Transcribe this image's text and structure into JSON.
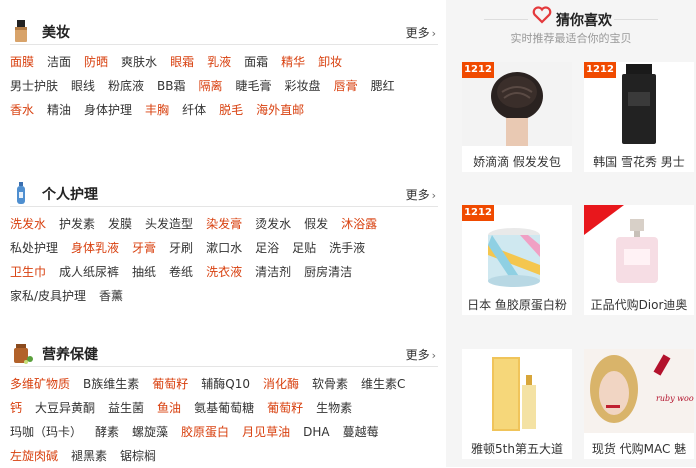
{
  "categories": [
    {
      "title": "美妆",
      "more": "更多",
      "rows": [
        [
          {
            "t": "面膜",
            "hot": true
          },
          {
            "t": "洁面",
            "hot": false
          },
          {
            "t": "防晒",
            "hot": true
          },
          {
            "t": "爽肤水",
            "hot": false
          },
          {
            "t": "眼霜",
            "hot": true
          },
          {
            "t": "乳液",
            "hot": true
          },
          {
            "t": "面霜",
            "hot": false
          },
          {
            "t": "精华",
            "hot": true
          },
          {
            "t": "卸妆",
            "hot": true
          }
        ],
        [
          {
            "t": "男士护肤",
            "hot": false
          },
          {
            "t": "眼线",
            "hot": false
          },
          {
            "t": "粉底液",
            "hot": false
          },
          {
            "t": "BB霜",
            "hot": false
          },
          {
            "t": "隔离",
            "hot": true
          },
          {
            "t": "睫毛膏",
            "hot": false
          },
          {
            "t": "彩妆盘",
            "hot": false
          },
          {
            "t": "唇膏",
            "hot": true
          },
          {
            "t": "腮红",
            "hot": false
          }
        ],
        [
          {
            "t": "香水",
            "hot": true
          },
          {
            "t": "精油",
            "hot": false
          },
          {
            "t": "身体护理",
            "hot": false
          },
          {
            "t": "丰胸",
            "hot": true
          },
          {
            "t": "纤体",
            "hot": false
          },
          {
            "t": "脱毛",
            "hot": true
          },
          {
            "t": "海外直邮",
            "hot": true
          }
        ]
      ]
    },
    {
      "title": "个人护理",
      "more": "更多",
      "rows": [
        [
          {
            "t": "洗发水",
            "hot": true
          },
          {
            "t": "护发素",
            "hot": false
          },
          {
            "t": "发膜",
            "hot": false
          },
          {
            "t": "头发造型",
            "hot": false
          },
          {
            "t": "染发膏",
            "hot": true
          },
          {
            "t": "烫发水",
            "hot": false
          },
          {
            "t": "假发",
            "hot": false
          },
          {
            "t": "沐浴露",
            "hot": true
          }
        ],
        [
          {
            "t": "私处护理",
            "hot": false
          },
          {
            "t": "身体乳液",
            "hot": true
          },
          {
            "t": "牙膏",
            "hot": true
          },
          {
            "t": "牙刷",
            "hot": false
          },
          {
            "t": "漱口水",
            "hot": false
          },
          {
            "t": "足浴",
            "hot": false
          },
          {
            "t": "足贴",
            "hot": false
          },
          {
            "t": "洗手液",
            "hot": false
          }
        ],
        [
          {
            "t": "卫生巾",
            "hot": true
          },
          {
            "t": "成人纸尿裤",
            "hot": false
          },
          {
            "t": "抽纸",
            "hot": false
          },
          {
            "t": "卷纸",
            "hot": false
          },
          {
            "t": "洗衣液",
            "hot": true
          },
          {
            "t": "清洁剂",
            "hot": false
          },
          {
            "t": "厨房清洁",
            "hot": false
          }
        ],
        [
          {
            "t": "家私/皮具护理",
            "hot": false
          },
          {
            "t": "香薰",
            "hot": false
          }
        ]
      ]
    },
    {
      "title": "营养保健",
      "more": "更多",
      "rows": [
        [
          {
            "t": "多维矿物质",
            "hot": true
          },
          {
            "t": "B族维生素",
            "hot": false
          },
          {
            "t": "葡萄籽",
            "hot": true
          },
          {
            "t": "辅酶Q10",
            "hot": false
          },
          {
            "t": "消化酶",
            "hot": true
          },
          {
            "t": "软骨素",
            "hot": false
          },
          {
            "t": "维生素C",
            "hot": false
          }
        ],
        [
          {
            "t": "钙",
            "hot": true
          },
          {
            "t": "大豆异黄酮",
            "hot": false
          },
          {
            "t": "益生菌",
            "hot": false
          },
          {
            "t": "鱼油",
            "hot": true
          },
          {
            "t": "氨基葡萄糖",
            "hot": false
          },
          {
            "t": "葡萄籽",
            "hot": true
          },
          {
            "t": "生物素",
            "hot": false
          }
        ],
        [
          {
            "t": "玛咖（玛卡）",
            "hot": false
          },
          {
            "t": "酵素",
            "hot": false
          },
          {
            "t": "螺旋藻",
            "hot": false
          },
          {
            "t": "胶原蛋白",
            "hot": true
          },
          {
            "t": "月见草油",
            "hot": true
          },
          {
            "t": "DHA",
            "hot": false
          },
          {
            "t": "蔓越莓",
            "hot": false
          }
        ],
        [
          {
            "t": "左旋肉碱",
            "hot": true
          },
          {
            "t": "褪黑素",
            "hot": false
          },
          {
            "t": "锯棕榈",
            "hot": false
          }
        ]
      ]
    }
  ],
  "favorites": {
    "title": "猜你喜欢",
    "subtitle": "实时推荐最适合你的宝贝",
    "items": [
      {
        "name": "娇滴滴 假发发包",
        "badge": "1212"
      },
      {
        "name": "韩国 雪花秀 男士",
        "badge": "1212"
      },
      {
        "name": "日本 鱼胶原蛋白粉",
        "badge": "1212"
      },
      {
        "name": "正品代购Dior迪奥",
        "badge": ""
      },
      {
        "name": "雅顿5th第五大道",
        "badge": ""
      },
      {
        "name": "现货 代购MAC 魅",
        "badge": ""
      }
    ]
  },
  "colors": {
    "hot": "#d8400f",
    "badge": "#f04a00",
    "heart": "#e4393c"
  }
}
